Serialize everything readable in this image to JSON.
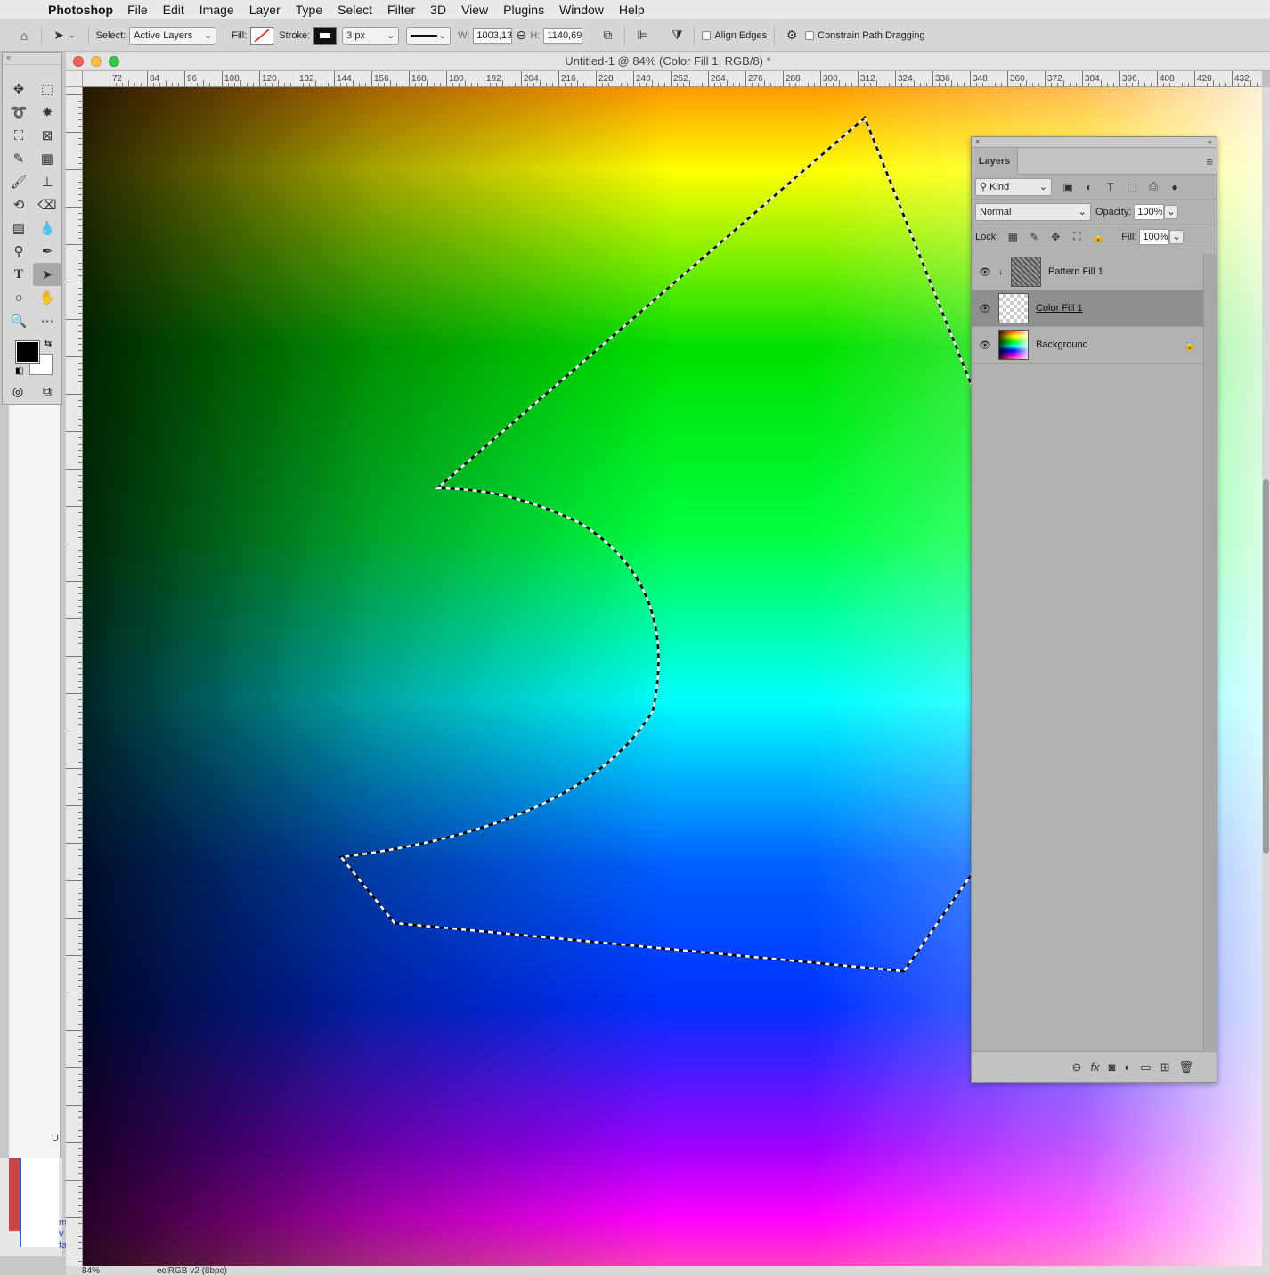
{
  "menubar": {
    "app": "Photoshop",
    "items": [
      "File",
      "Edit",
      "Image",
      "Layer",
      "Type",
      "Select",
      "Filter",
      "3D",
      "View",
      "Plugins",
      "Window",
      "Help"
    ]
  },
  "options": {
    "select_label": "Select:",
    "select_value": "Active Layers",
    "fill_label": "Fill:",
    "stroke_label": "Stroke:",
    "stroke_width": "3 px",
    "w_label": "W:",
    "w_value": "1003,13",
    "h_label": "H:",
    "h_value": "1140,69",
    "align_edges": "Align Edges",
    "constrain": "Constrain Path Dragging"
  },
  "document": {
    "title": "Untitled-1 @ 84% (Color Fill 1, RGB/8) *",
    "ruler_labels": [
      "72",
      "84",
      "96",
      "108",
      "120",
      "132",
      "144",
      "156",
      "168",
      "180",
      "192",
      "204",
      "216",
      "228",
      "240",
      "252",
      "264",
      "276",
      "288",
      "300",
      "312",
      "324",
      "336",
      "348",
      "360",
      "372",
      "384",
      "396",
      "408",
      "420",
      "432"
    ],
    "status_zoom": "84%",
    "status_profile": "eciRGB v2 (8bpc)"
  },
  "layers_panel": {
    "tab": "Layers",
    "filter_kind": "Kind",
    "blend_mode": "Normal",
    "opacity_label": "Opacity:",
    "opacity_value": "100%",
    "lock_label": "Lock:",
    "fill_label": "Fill:",
    "fill_value": "100%",
    "layers": [
      {
        "name": "Pattern Fill 1",
        "visible": true,
        "selected": false
      },
      {
        "name": "Color Fill 1",
        "visible": true,
        "selected": true
      },
      {
        "name": "Background",
        "visible": true,
        "selected": false,
        "locked": true
      }
    ]
  },
  "ghost": {
    "u": "U",
    "text": "m\nv\nfa"
  }
}
